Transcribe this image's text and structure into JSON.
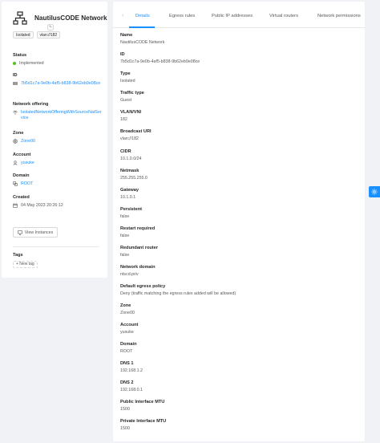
{
  "network": {
    "title": "NautilusCODE Network",
    "tags": [
      "Isolated",
      "vlan://182"
    ]
  },
  "left": {
    "status_label": "Status",
    "status_value": "Implemented",
    "id_label": "ID",
    "id_value": "7b5d1c7a-9e0b-4af5-b838-9b62eb9e08ce",
    "offering_label": "Network offering",
    "offering_value": "IsolatedNetworkOfferingWithSourceNatService",
    "zone_label": "Zone",
    "zone_value": "Zone00",
    "account_label": "Account",
    "account_value": "yusuke",
    "domain_label": "Domain",
    "domain_value": "ROOT",
    "created_label": "Created",
    "created_value": "04 May 2023 20:26:12",
    "view_instances": "View Instances",
    "tags_label": "Tags",
    "new_tag": "+ New tag"
  },
  "tabs": [
    "Details",
    "Egress rules",
    "Public IP addresses",
    "Virtual routers",
    "Network permissions"
  ],
  "details": [
    {
      "label": "Name",
      "value": "NautilusCODE Network"
    },
    {
      "label": "ID",
      "value": "7b5d1c7a-9e0b-4af5-b838-9b62eb9e08ce"
    },
    {
      "label": "Type",
      "value": "Isolated"
    },
    {
      "label": "Traffic type",
      "value": "Guest"
    },
    {
      "label": "VLAN/VNI",
      "value": "182"
    },
    {
      "label": "Broadcast URI",
      "value": "vlan://182"
    },
    {
      "label": "CIDR",
      "value": "10.1.0.0/24"
    },
    {
      "label": "Netmask",
      "value": "255.255.255.0"
    },
    {
      "label": "Gateway",
      "value": "10.1.0.1"
    },
    {
      "label": "Persistent",
      "value": "false"
    },
    {
      "label": "Restart required",
      "value": "false"
    },
    {
      "label": "Redundant router",
      "value": "false"
    },
    {
      "label": "Network domain",
      "value": "ntscd.priv"
    },
    {
      "label": "Default egress policy",
      "value": "Deny (traffic matching the egress rules added will be allowed)"
    },
    {
      "label": "Zone",
      "value": "Zone00"
    },
    {
      "label": "Account",
      "value": "yusuke"
    },
    {
      "label": "Domain",
      "value": "ROOT"
    },
    {
      "label": "DNS 1",
      "value": "192.168.1.2"
    },
    {
      "label": "DNS 2",
      "value": "192.168.0.1"
    },
    {
      "label": "Public Interface MTU",
      "value": "1500"
    },
    {
      "label": "Private Interface MTU",
      "value": "1500"
    }
  ],
  "colors": {
    "accent": "#1890ff",
    "status_ok": "#52c41a"
  }
}
